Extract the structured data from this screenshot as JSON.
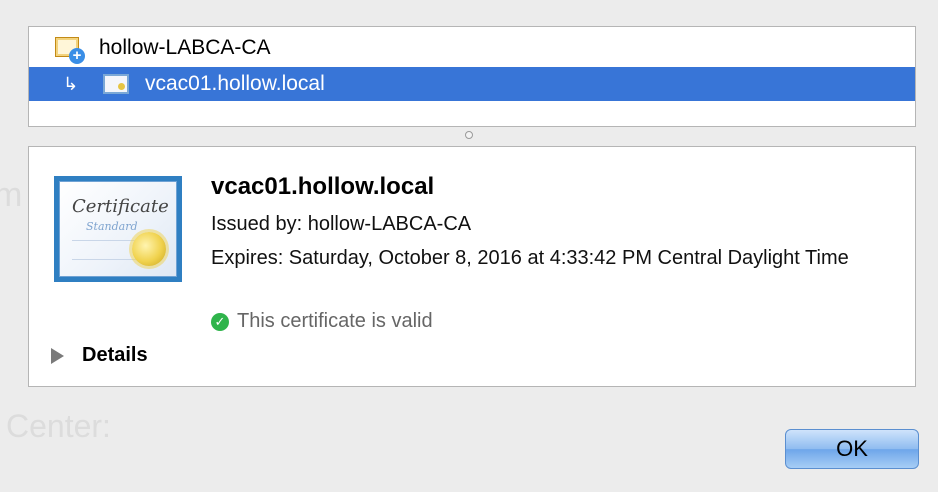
{
  "background": {
    "ghost_text_top": "m",
    "ghost_text_bottom": "Center:"
  },
  "chain": {
    "root": {
      "label": "hollow-LABCA-CA",
      "icon": "certificate-authority-icon"
    },
    "leaf": {
      "arrow": "↳",
      "label": "vcac01.hollow.local",
      "icon": "certificate-icon",
      "selected": true
    }
  },
  "detail": {
    "badge": {
      "title": "Certificate",
      "subtitle": "Standard"
    },
    "name": "vcac01.hollow.local",
    "issued_by": "Issued by: hollow-LABCA-CA",
    "expires": "Expires: Saturday, October 8, 2016 at 4:33:42 PM Central Daylight Time",
    "status": "This certificate is valid",
    "status_icon": "check-circle-icon",
    "status_color": "#2fb44b",
    "details_label": "Details"
  },
  "buttons": {
    "ok": "OK"
  },
  "colors": {
    "selection": "#3875d7",
    "badge_frame": "#2f7fc2"
  }
}
